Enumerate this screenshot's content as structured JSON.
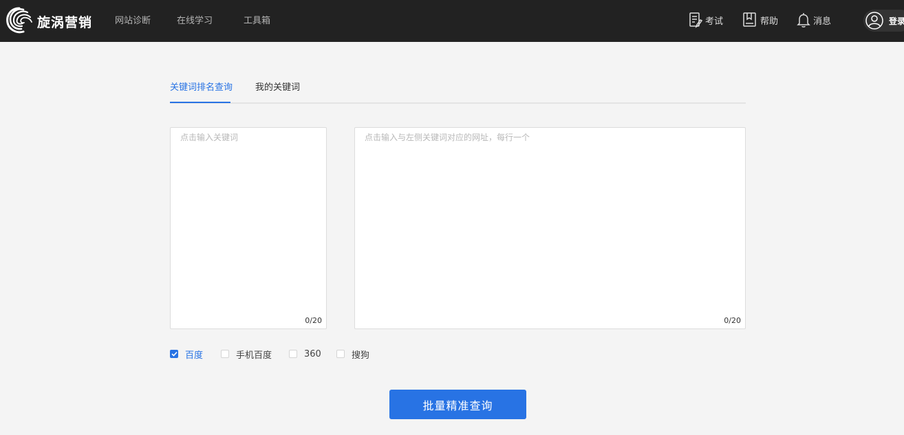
{
  "header": {
    "brand": "旋涡营销",
    "nav": [
      "网站诊断",
      "在线学习",
      "工具箱"
    ],
    "exam": "考试",
    "help": "帮助",
    "messages": "消息",
    "login": "登录"
  },
  "tabs": {
    "items": [
      "关键词排名查询",
      "我的关键词"
    ],
    "active": "关键词排名查询"
  },
  "keywords_box": {
    "placeholder": "点击输入关键词",
    "value": "",
    "counter": "0/20"
  },
  "urls_box": {
    "placeholder": "点击输入与左侧关键词对应的网址，每行一个",
    "value": "",
    "counter": "0/20"
  },
  "engines": [
    {
      "label": "百度",
      "checked": true
    },
    {
      "label": "手机百度",
      "checked": false
    },
    {
      "label": "360",
      "checked": false
    },
    {
      "label": "搜狗",
      "checked": false
    }
  ],
  "submit_label": "批量精准查询",
  "colors": {
    "topbar": "#222222",
    "accent": "#2873e4",
    "page_bg": "#f4f4f4"
  }
}
